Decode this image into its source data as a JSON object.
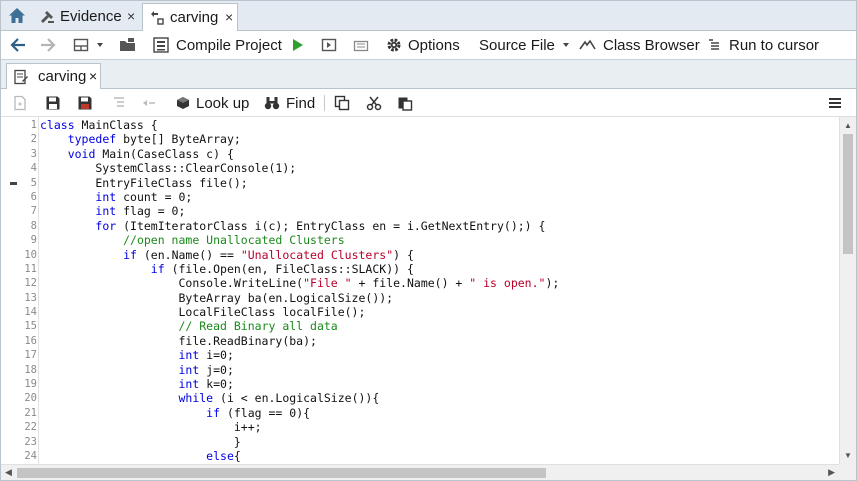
{
  "top_tabs": [
    {
      "label": "Evidence",
      "icon": "evidence-icon",
      "active": false
    },
    {
      "label": "carving",
      "icon": "script-icon",
      "active": true
    }
  ],
  "toolbar": {
    "compile_label": "Compile Project",
    "options_label": "Options",
    "source_file_label": "Source File",
    "class_browser_label": "Class Browser",
    "run_to_cursor_label": "Run to cursor"
  },
  "editor_tab": {
    "label": "carving"
  },
  "editor_toolbar": {
    "lookup_label": "Look up",
    "find_label": "Find"
  },
  "colors": {
    "keyword": "#0000e6",
    "comment": "#1b8a1b",
    "string": "#b8002a",
    "run_green": "#2da12d"
  },
  "code_lines": [
    "class MainClass {",
    "    typedef byte[] ByteArray;",
    "    void Main(CaseClass c) {",
    "        SystemClass::ClearConsole(1);",
    "        EntryFileClass file();",
    "        int count = 0;",
    "        int flag = 0;",
    "        for (ItemIteratorClass i(c); EntryClass en = i.GetNextEntry();) {",
    "            //open name Unallocated Clusters",
    "            if (en.Name() == \"Unallocated Clusters\") {",
    "                if (file.Open(en, FileClass::SLACK)) {",
    "                    Console.WriteLine(\"File \" + file.Name() + \" is open.\");",
    "                    ByteArray ba(en.LogicalSize());",
    "                    LocalFileClass localFile();",
    "                    // Read Binary all data",
    "                    file.ReadBinary(ba);",
    "                    int i=0;",
    "                    int j=0;",
    "                    int k=0;",
    "                    while (i < en.LogicalSize()){",
    "                        if (flag == 0){",
    "                            i++;",
    "                            }",
    "                        else{"
  ]
}
